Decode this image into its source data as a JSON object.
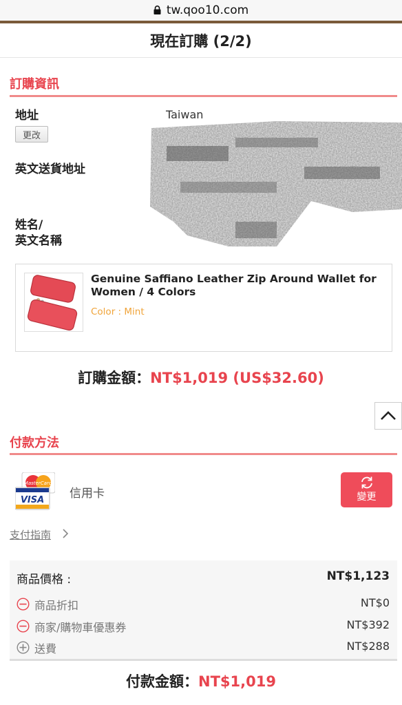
{
  "browser": {
    "url": "tw.qoo10.com"
  },
  "header": {
    "title": "現在訂購 (2/2)"
  },
  "order_info": {
    "section_title": "訂購資訊",
    "address_label": "地址",
    "change_button": "更改",
    "country": "Taiwan",
    "english_address_label": "英文送貨地址",
    "name_label_line1": "姓名/",
    "name_label_line2": "英文名稱"
  },
  "product": {
    "name": "Genuine Saffiano Leather Zip Around Wallet for Women / 4 Colors",
    "option": "Color : Mint"
  },
  "order_amount": {
    "label": "訂購金額：",
    "value": "NT$1,019 (US$32.60)"
  },
  "payment": {
    "section_title": "付款方法",
    "method": "信用卡",
    "change_button": "變更",
    "guide_link": "支付指南"
  },
  "price_summary": {
    "product_price_label": "商品價格 :",
    "product_price_value": "NT$1,123",
    "discount_label": "商品折扣",
    "discount_value": "NT$0",
    "coupon_label": "商家/購物車優惠券",
    "coupon_value": "NT$392",
    "shipping_label": "送費",
    "shipping_value": "NT$288"
  },
  "payment_total": {
    "label": "付款金額：",
    "value": "NT$1,019"
  },
  "colors": {
    "accent": "#e8444e",
    "accent_line": "#f08a8a",
    "option_orange": "#f0a43a",
    "brown_bar": "#7a5a3a"
  }
}
